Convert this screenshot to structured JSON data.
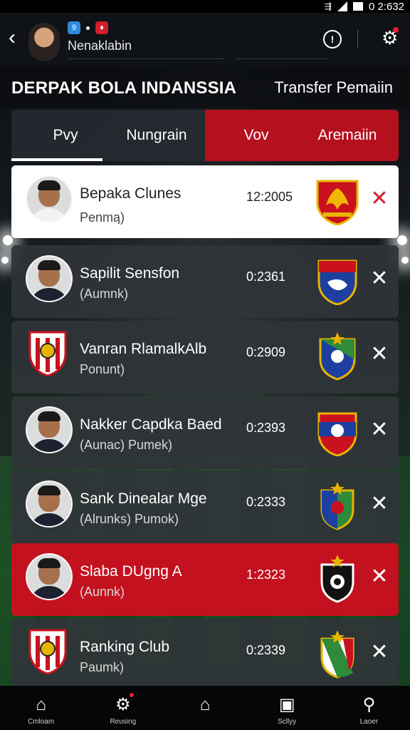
{
  "status_bar": {
    "time": "0 2:632"
  },
  "header": {
    "username": "Nenaklabin",
    "badge_1": "9",
    "badge_2": "♦"
  },
  "title_bar": {
    "title": "DERPAK BOLA INDANSSIA",
    "transfer_link": "Transfer Pemaiin"
  },
  "tabs": [
    {
      "label": "Pvy",
      "active": true
    },
    {
      "label": "Nungrain"
    },
    {
      "label": "Vov"
    },
    {
      "label": "Aremaiin"
    }
  ],
  "players": [
    {
      "name": "Bepaka Clunes",
      "sub": "Penmaฺ)",
      "time": "12:2005",
      "avatar": "player-photo",
      "crest": "phoenix-crest",
      "style": "white"
    },
    {
      "name": "Sapilit Sensfon",
      "sub": "(Aumnk)",
      "time": "0:2361",
      "avatar": "player-photo",
      "crest": "blue-red-crest",
      "style": "dark"
    },
    {
      "name": "Vanran RlamalkAlb",
      "sub": "Ponunt)",
      "time": "0:2909",
      "avatar": "club-shield",
      "crest": "green-gold-crest",
      "style": "dark"
    },
    {
      "name": "Nakker Capdka Baed",
      "sub": "(Aunac) Pumek)",
      "time": "0:2393",
      "avatar": "player-photo",
      "crest": "red-blue-crest",
      "style": "dark"
    },
    {
      "name": "Sank Dinealar Mge",
      "sub": "(Alrunks) Pumok)",
      "time": "0:2333",
      "avatar": "player-photo",
      "crest": "green-red-crest",
      "style": "dark"
    },
    {
      "name": "Slaba DUgng A",
      "sub": "(Aunnk)",
      "time": "1:2323",
      "avatar": "player-photo",
      "crest": "black-crest",
      "style": "red"
    },
    {
      "name": "Ranking Club",
      "sub": "Paumk)",
      "time": "0:2339",
      "avatar": "club-shield",
      "crest": "white-green-red-crest",
      "style": "dark"
    }
  ],
  "bottom_nav": [
    {
      "label": "Cmloam",
      "icon": "home-icon"
    },
    {
      "label": "Reusing",
      "icon": "gear-icon"
    },
    {
      "label": "",
      "icon": "house-outline-icon"
    },
    {
      "label": "Scllyy",
      "icon": "box-icon"
    },
    {
      "label": "Laoer",
      "icon": "search-user-icon"
    }
  ],
  "colors": {
    "accent_red": "#c4111f",
    "dark_card": "#303438"
  }
}
